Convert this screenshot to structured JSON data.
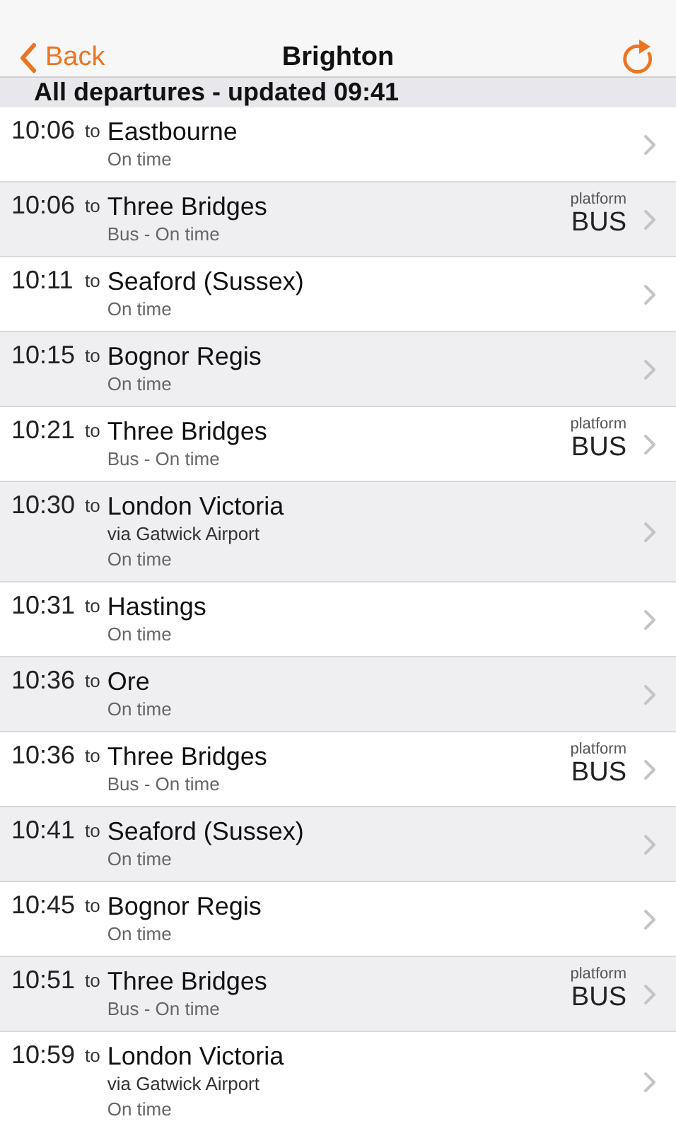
{
  "nav_bar": {
    "back": "Back",
    "title": "Brighton"
  },
  "section_header": "All departures - updated 09:41",
  "departures": [
    {
      "time": "10:06",
      "to": "to",
      "destination": "Eastbourne",
      "status": "On time"
    },
    {
      "time": "10:06",
      "to": "to",
      "destination": "Three Bridges",
      "status": "Bus - On time",
      "platform": {
        "label": "platform",
        "value": "BUS"
      }
    },
    {
      "time": "10:11",
      "to": "to",
      "destination": "Seaford (Sussex)",
      "status": "On time"
    },
    {
      "time": "10:15",
      "to": "to",
      "destination": "Bognor Regis",
      "status": "On time"
    },
    {
      "time": "10:21",
      "to": "to",
      "destination": "Three Bridges",
      "status": "Bus - On time",
      "platform": {
        "label": "platform",
        "value": "BUS"
      }
    },
    {
      "time": "10:30",
      "to": "to",
      "destination": "London Victoria",
      "via": "via Gatwick Airport",
      "status": "On time"
    },
    {
      "time": "10:31",
      "to": "to",
      "destination": "Hastings",
      "status": "On time"
    },
    {
      "time": "10:36",
      "to": "to",
      "destination": "Ore",
      "status": "On time"
    },
    {
      "time": "10:36",
      "to": "to",
      "destination": "Three Bridges",
      "status": "Bus - On time",
      "platform": {
        "label": "platform",
        "value": "BUS"
      }
    },
    {
      "time": "10:41",
      "to": "to",
      "destination": "Seaford (Sussex)",
      "status": "On time"
    },
    {
      "time": "10:45",
      "to": "to",
      "destination": "Bognor Regis",
      "status": "On time"
    },
    {
      "time": "10:51",
      "to": "to",
      "destination": "Three Bridges",
      "status": "Bus - On time",
      "platform": {
        "label": "platform",
        "value": "BUS"
      }
    },
    {
      "time": "10:59",
      "to": "to",
      "destination": "London Victoria",
      "via": "via Gatwick Airport",
      "status": "On time"
    }
  ]
}
